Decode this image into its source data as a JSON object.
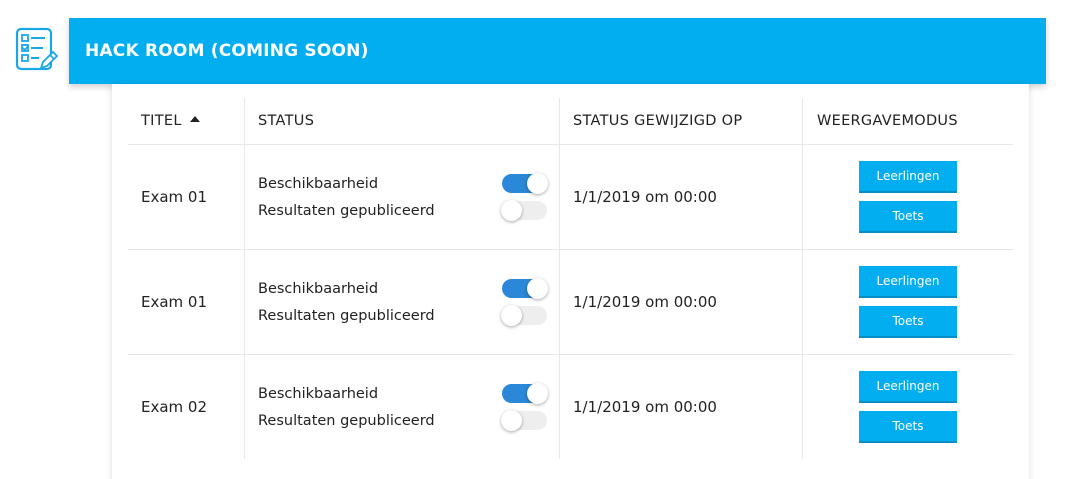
{
  "header": {
    "title": "HACK ROOM (COMING SOON)",
    "icon": "exam-document-icon",
    "color": "#03aef0"
  },
  "table": {
    "columns": [
      "TITEL",
      "STATUS",
      "STATUS GEWIJZIGD OP",
      "WEERGAVEMODUS"
    ],
    "sort_column": "TITEL",
    "sort_direction": "ascending",
    "rows": [
      {
        "title": "Exam 01",
        "availability_label": "Beschikbaarheid",
        "availability_on": true,
        "published_label": "Resultaten gepubliceerd",
        "published_on": false,
        "changed_on": "1/1/2019 om 00:00",
        "students_button": "Leerlingen",
        "test_button": "Toets"
      },
      {
        "title": "Exam 01",
        "availability_label": "Beschikbaarheid",
        "availability_on": true,
        "published_label": "Resultaten gepubliceerd",
        "published_on": false,
        "changed_on": "1/1/2019 om 00:00",
        "students_button": "Leerlingen",
        "test_button": "Toets"
      },
      {
        "title": "Exam 02",
        "availability_label": "Beschikbaarheid",
        "availability_on": true,
        "published_label": "Resultaten gepubliceerd",
        "published_on": false,
        "changed_on": "1/1/2019 om 00:00",
        "students_button": "Leerlingen",
        "test_button": "Toets"
      }
    ]
  },
  "colors": {
    "toggle_on": "#2b87d8",
    "toggle_off": "#eeeeee",
    "button": "#03aef0"
  }
}
